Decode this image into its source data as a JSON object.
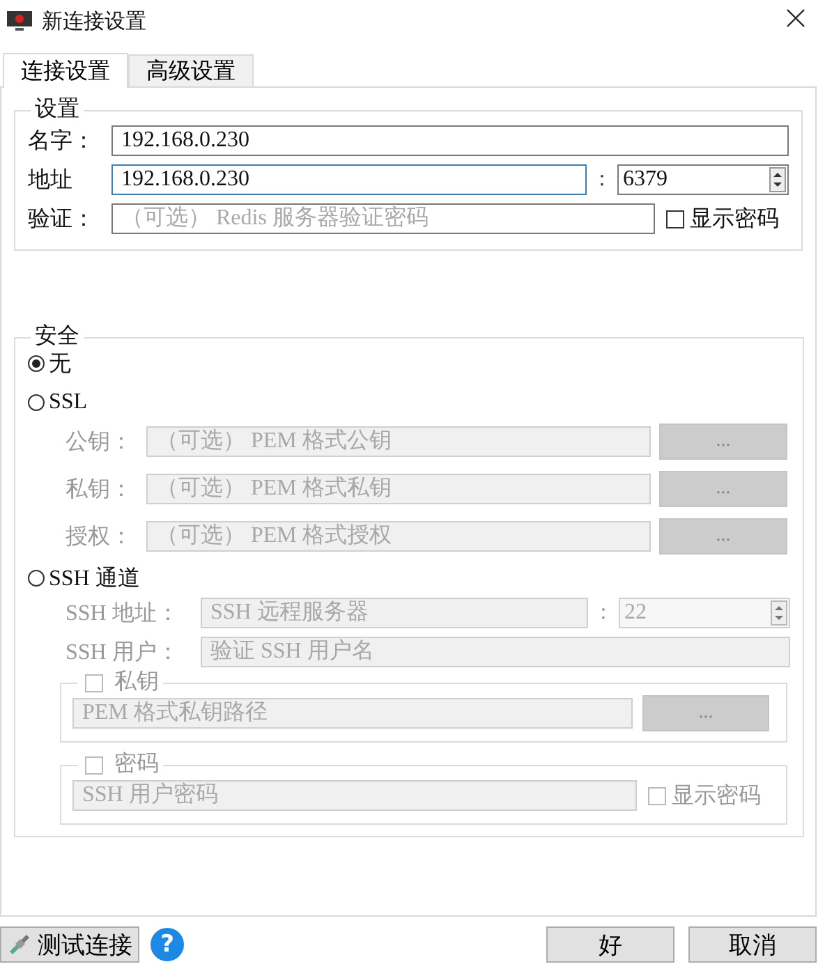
{
  "window": {
    "title": "新连接设置"
  },
  "tabs": [
    {
      "label": "连接设置",
      "selected": true
    },
    {
      "label": "高级设置",
      "selected": false
    }
  ],
  "settings": {
    "title": "设置",
    "name": {
      "label": "名字：",
      "value": "192.168.0.230"
    },
    "address": {
      "label": "地址",
      "value": "192.168.0.230",
      "separator": ":",
      "port": "6379"
    },
    "auth": {
      "label": "验证：",
      "placeholder": "（可选） Redis 服务器验证密码",
      "show_password": {
        "label": "显示密码",
        "checked": false
      }
    }
  },
  "security": {
    "title": "安全",
    "none": {
      "label": "无",
      "selected": true
    },
    "ssl": {
      "label": "SSL",
      "selected": false,
      "disabled": true,
      "fields": [
        {
          "label": "公钥：",
          "placeholder": "（可选） PEM 格式公钥",
          "button": "..."
        },
        {
          "label": "私钥：",
          "placeholder": "（可选） PEM 格式私钥",
          "button": "..."
        },
        {
          "label": "授权：",
          "placeholder": "（可选） PEM 格式授权",
          "button": "..."
        }
      ]
    },
    "ssh": {
      "label": "SSH 通道",
      "selected": false,
      "disabled": true,
      "address": {
        "label": "SSH 地址：",
        "placeholder": "SSH 远程服务器",
        "separator": ":",
        "port": "22"
      },
      "user": {
        "label": "SSH 用户：",
        "placeholder": "验证 SSH 用户名"
      },
      "private_key": {
        "label": "私钥",
        "checked": false,
        "placeholder": "PEM 格式私钥路径",
        "button": "..."
      },
      "password": {
        "label": "密码",
        "checked": false,
        "placeholder": "SSH 用户密码",
        "show_password": {
          "label": "显示密码",
          "checked": false
        }
      }
    }
  },
  "footer": {
    "test_button": "测试连接",
    "help": "?",
    "ok": "好",
    "cancel": "取消"
  }
}
